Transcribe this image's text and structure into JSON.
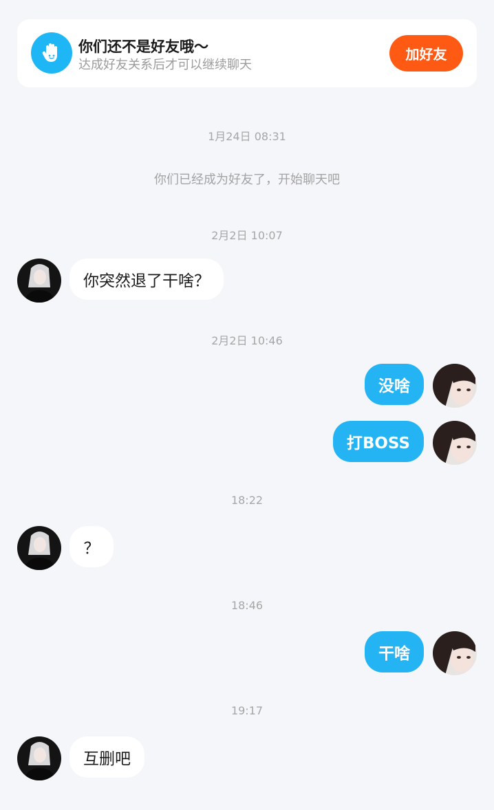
{
  "banner": {
    "icon": "waving-hand-icon",
    "title": "你们还不是好友哦～",
    "subtitle": "达成好友关系后才可以继续聊天",
    "add_button": "加好友",
    "colors": {
      "icon_bg": "#1fb6f5",
      "button_bg": "#ff5a14"
    }
  },
  "timeline": {
    "t1": "1月24日 08:31",
    "system_msg": "你们已经成为好友了，开始聊天吧",
    "t2": "2月2日 10:07",
    "t3": "2月2日 10:46",
    "t4": "18:22",
    "t5": "18:46",
    "t6": "19:17"
  },
  "messages": {
    "m1": "你突然退了干啥？",
    "m2": "没啥",
    "m3": "打BOSS",
    "m4": "？",
    "m5": "干啥",
    "m6": "互删吧"
  },
  "colors": {
    "outgoing_bubble": "#24b3f3",
    "incoming_bubble": "#ffffff",
    "background": "#f4f6f9"
  }
}
